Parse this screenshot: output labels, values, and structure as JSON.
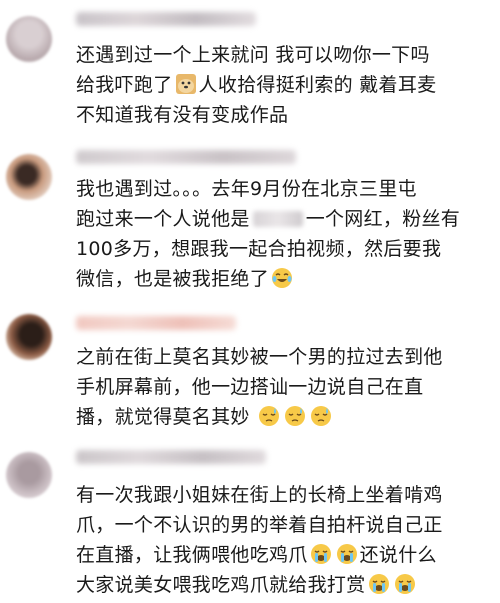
{
  "comments": [
    {
      "lines": [
        [
          "还遇到过一个上来就问 我可以吻你一下吗"
        ],
        [
          "给我吓跑了",
          "人收拾得挺利索的 戴着耳麦"
        ],
        [
          "不知道我有没有变成作品"
        ]
      ],
      "emoji": [
        "doge-emoji"
      ]
    },
    {
      "lines": [
        [
          "我也遇到过。。。去年9月份在北京三里屯"
        ],
        [
          "跑过来一个人说他是",
          "一个网红，粉丝有"
        ],
        [
          "100多万，想跟我一起合拍视频，然后要我"
        ],
        [
          "微信，也是被我拒绝了"
        ]
      ],
      "emoji": [
        "laughing-tears-emoji"
      ]
    },
    {
      "lines": [
        [
          "之前在街上莫名其妙被一个男的拉过去到他"
        ],
        [
          "手机屏幕前，他一边搭讪一边说自己在直"
        ],
        [
          "播，就觉得莫名其妙"
        ]
      ],
      "emoji": [
        "sweat-emoji",
        "sweat-emoji",
        "sweat-emoji"
      ]
    },
    {
      "lines": [
        [
          "有一次我跟小姐妹在街上的长椅上坐着啃鸡"
        ],
        [
          "爪，一个不认识的男的举着自拍杆说自己正"
        ],
        [
          "在直播，让我俩喂他吃鸡爪",
          "还说什么"
        ],
        [
          "大家说美女喂我吃鸡爪就给我打赏"
        ]
      ],
      "emoji": [
        "crying-emoji",
        "crying-emoji",
        "crying-emoji",
        "crying-emoji"
      ]
    }
  ],
  "colors": {
    "text": "#1a1a1a",
    "emoji_yellow": "#f7c948"
  }
}
